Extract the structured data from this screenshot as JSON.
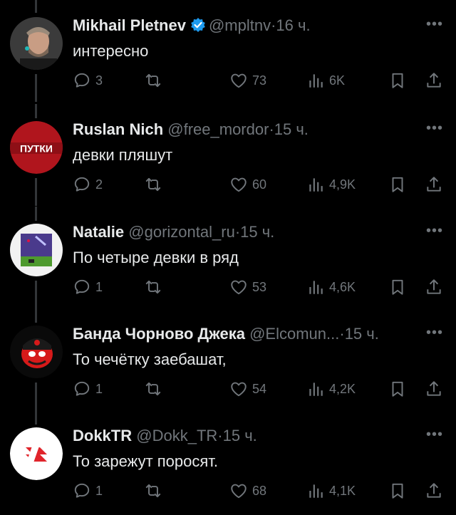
{
  "tweets": [
    {
      "name": "Mikhail Pletnev",
      "verified": true,
      "handle": "@mpltnv",
      "dot": "·",
      "time": "16 ч.",
      "text": "интересно",
      "replies": "3",
      "likes": "73",
      "views": "6K"
    },
    {
      "name": "Ruslan Nich",
      "verified": false,
      "handle": "@free_mordor",
      "dot": "·",
      "time": "15 ч.",
      "text": "девки пляшут",
      "replies": "2",
      "likes": "60",
      "views": "4,9K",
      "avatar_text": "ПУТКИ"
    },
    {
      "name": "Natalie",
      "verified": false,
      "handle": "@gorizontal_ru",
      "dot": "·",
      "time": "15 ч.",
      "text": "По четыре девки в ряд",
      "replies": "1",
      "likes": "53",
      "views": "4,6K"
    },
    {
      "name": "Банда Чорново Джека",
      "verified": false,
      "handle": "@Elcomun...",
      "dot": "·",
      "time": "15 ч.",
      "text": "То чечётку заебашат,",
      "replies": "1",
      "likes": "54",
      "views": "4,2K"
    },
    {
      "name": "DokkTR",
      "verified": false,
      "handle": "@Dokk_TR",
      "dot": "·",
      "time": "15 ч.",
      "text": "То зарежут поросят.",
      "replies": "1",
      "likes": "68",
      "views": "4,1K"
    }
  ],
  "colors": {
    "background": "#000000",
    "text": "#e7e9ea",
    "muted": "#71767b",
    "verified": "#1d9bf0",
    "thread": "#333639"
  },
  "icons": {
    "reply": "reply-icon",
    "retweet": "retweet-icon",
    "like": "heart-icon",
    "views": "views-icon",
    "bookmark": "bookmark-icon",
    "share": "share-icon",
    "more": "more-icon"
  }
}
